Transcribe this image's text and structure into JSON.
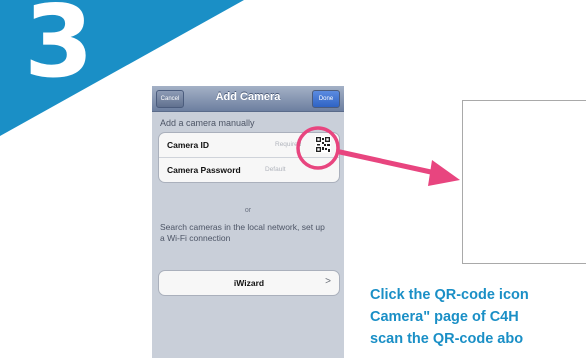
{
  "step": {
    "number": "3"
  },
  "phone": {
    "nav": {
      "cancel_label": "Cancel",
      "title": "Add Camera",
      "done_label": "Done"
    },
    "manual_section_label": "Add a camera manually",
    "fields": [
      {
        "label": "Camera ID",
        "hint": "Required"
      },
      {
        "label": "Camera Password",
        "hint": "Default"
      }
    ],
    "or_label": "or",
    "search_text": "Search cameras in the local network, set up a Wi-Fi connection",
    "iwizard_label": "iWizard",
    "iwizard_chevron": ">"
  },
  "instruction": {
    "line1": "Click the QR-code icon",
    "line2": "Camera\" page of  C4H",
    "line3": "scan the QR-code abo"
  },
  "colors": {
    "badge_blue": "#1a8fc6",
    "highlight_pink": "#e8457f",
    "instruction_blue": "#1a8fc6"
  },
  "icons": {
    "qr": "qr-code-icon",
    "chevron": "chevron-right-icon",
    "arrow": "arrow-right-icon"
  }
}
